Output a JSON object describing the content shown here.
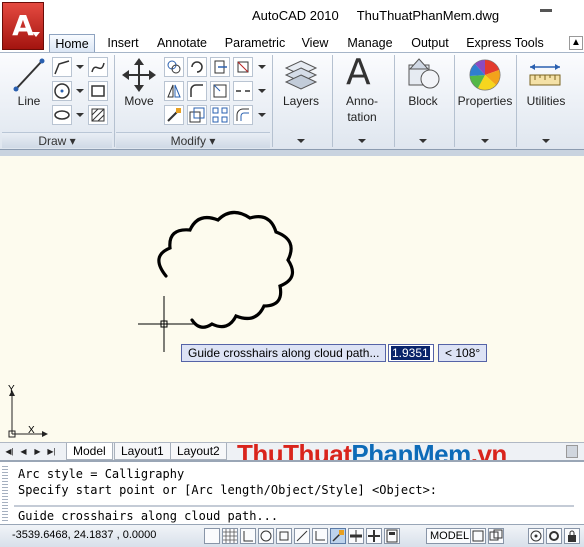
{
  "window": {
    "app_title": "AutoCAD 2010",
    "file_name": "ThuThuatPhanMem.dwg"
  },
  "ribbon_tabs": [
    {
      "label": "Home",
      "active": true
    },
    {
      "label": "Insert"
    },
    {
      "label": "Annotate"
    },
    {
      "label": "Parametric"
    },
    {
      "label": "View"
    },
    {
      "label": "Manage"
    },
    {
      "label": "Output"
    },
    {
      "label": "Express Tools"
    }
  ],
  "panels": {
    "draw": {
      "title": "Draw",
      "line_label": "Line"
    },
    "modify": {
      "title": "Modify",
      "move_label": "Move"
    },
    "layers": {
      "label": "Layers"
    },
    "annotation": {
      "label_line1": "Anno-",
      "label_line2": "tation"
    },
    "block": {
      "label": "Block"
    },
    "properties": {
      "label": "Properties"
    },
    "utilities": {
      "label": "Utilities"
    }
  },
  "canvas": {
    "tooltip": "Guide crosshairs along cloud path...",
    "dynamic_input_value": "1.9351",
    "angle_value": "< 108°",
    "ucs_y": "Y",
    "ucs_x": "X"
  },
  "layout_tabs": [
    {
      "label": "Model",
      "active": true
    },
    {
      "label": "Layout1"
    },
    {
      "label": "Layout2"
    }
  ],
  "watermark": {
    "part1": "ThuThuat",
    "part2": "PhanMem",
    "part3": ".vn"
  },
  "command_line": {
    "history": [
      "Arc style = Calligraphy",
      "Specify start point or [Arc length/Object/Style] <Object>:"
    ],
    "prompt": "Guide crosshairs along cloud path..."
  },
  "status_bar": {
    "coordinates": "-3539.6468, 24.1837 , 0.0000",
    "model_label": "MODEL"
  },
  "colors": {
    "canvas_bg": "#fdfbee",
    "accent_red": "#d9241c",
    "accent_blue": "#0d6bb8"
  }
}
